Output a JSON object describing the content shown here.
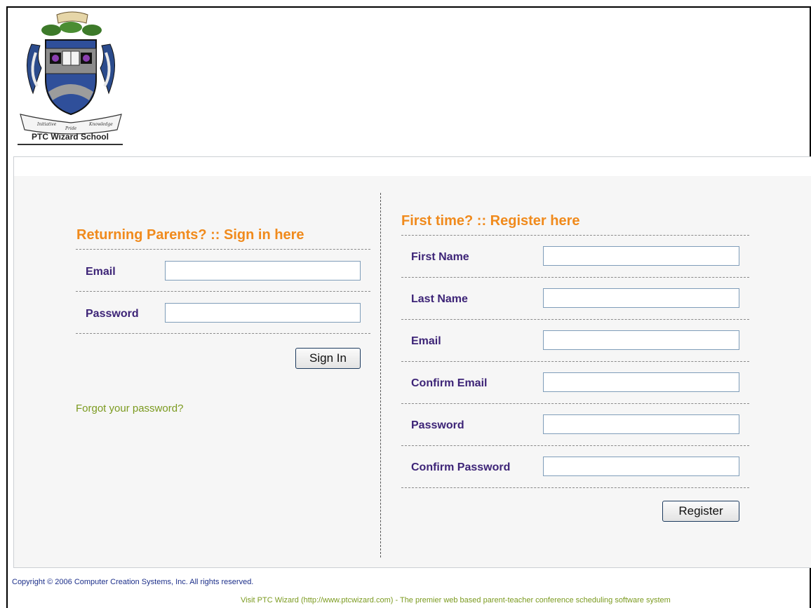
{
  "header": {
    "school_name": "PTC Wizard School",
    "crest_text": {
      "left": "Initiative",
      "center": "Pride",
      "right": "Knowledge"
    }
  },
  "signin": {
    "heading": "Returning Parents? :: Sign in here",
    "email_label": "Email",
    "email_value": "",
    "password_label": "Password",
    "password_value": "",
    "button": "Sign In",
    "forgot_link": "Forgot your password?"
  },
  "register": {
    "heading": "First time? :: Register here",
    "fields": [
      {
        "label": "First Name",
        "value": ""
      },
      {
        "label": "Last Name",
        "value": ""
      },
      {
        "label": "Email",
        "value": ""
      },
      {
        "label": "Confirm Email",
        "value": ""
      },
      {
        "label": "Password",
        "value": ""
      },
      {
        "label": "Confirm Password",
        "value": ""
      }
    ],
    "button": "Register"
  },
  "footer": {
    "copyright": "Copyright © 2006 Computer Creation Systems, Inc. All rights reserved.",
    "visit": "Visit PTC Wizard (http://www.ptcwizard.com) - The premier web based parent-teacher conference scheduling software system"
  },
  "colors": {
    "heading": "#f08a1c",
    "label": "#3d2477",
    "link": "#7b9a1f",
    "copyright": "#1c2f8a"
  }
}
